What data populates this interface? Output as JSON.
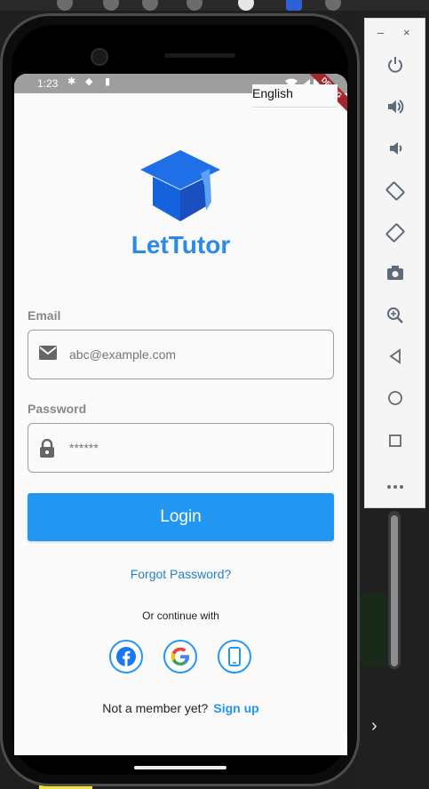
{
  "status_bar": {
    "time": "1:23"
  },
  "debug_banner": "DEBUG",
  "language": {
    "selected": "English"
  },
  "app": {
    "name": "LetTutor"
  },
  "email": {
    "label": "Email",
    "placeholder": "abc@example.com"
  },
  "password": {
    "label": "Password",
    "placeholder": "******"
  },
  "actions": {
    "login": "Login",
    "forgot_password": "Forgot Password?",
    "or_continue": "Or continue with",
    "not_member": "Not a member yet?",
    "sign_up": "Sign up"
  },
  "social_logins": [
    {
      "icon": "facebook-icon"
    },
    {
      "icon": "google-icon"
    },
    {
      "icon": "phone-icon"
    }
  ],
  "emulator_toolbar": {
    "minimize": "–",
    "close": "×",
    "buttons": [
      "power-icon",
      "volume-up-icon",
      "volume-down-icon",
      "rotate-left-icon",
      "rotate-right-icon",
      "camera-icon",
      "zoom-icon",
      "back-icon",
      "home-icon",
      "overview-icon",
      "more-icon"
    ]
  },
  "colors": {
    "primary": "#2196f3",
    "brand_text": "#2b8ae6",
    "background": "#fafafa"
  }
}
